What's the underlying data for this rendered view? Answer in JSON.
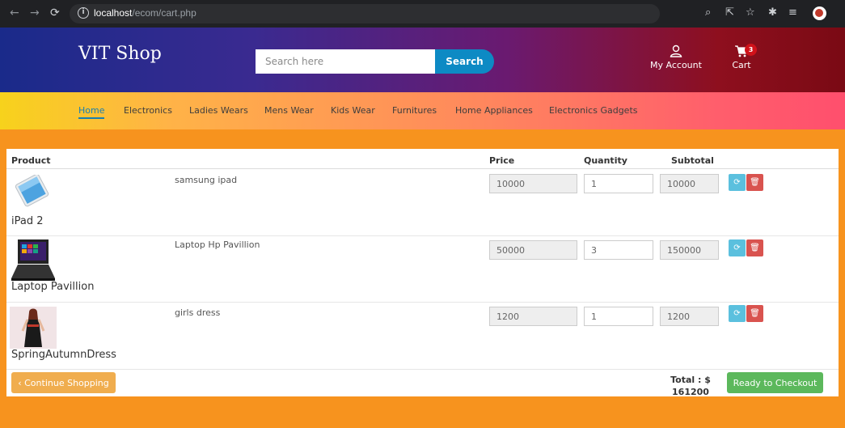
{
  "browser": {
    "host": "localhost",
    "path": "/ecom/cart.php"
  },
  "header": {
    "brand": "VIT Shop",
    "search_placeholder": "Search here",
    "search_label": "Search",
    "account_label": "My Account",
    "cart_label": "Cart",
    "cart_count": "3"
  },
  "categories": [
    {
      "label": "Home",
      "active": true
    },
    {
      "label": "Electronics"
    },
    {
      "label": "Ladies Wears"
    },
    {
      "label": "Mens Wear"
    },
    {
      "label": "Kids Wear"
    },
    {
      "label": "Furnitures"
    },
    {
      "label": "Home Appliances"
    },
    {
      "label": "Electronics Gadgets"
    }
  ],
  "cart": {
    "columns": {
      "product": "Product",
      "price": "Price",
      "quantity": "Quantity",
      "subtotal": "Subtotal"
    },
    "items": [
      {
        "name": "iPad 2",
        "description": "samsung ipad",
        "price": "10000",
        "quantity": "1",
        "subtotal": "10000"
      },
      {
        "name": "Laptop Pavillion",
        "description": "Laptop Hp Pavillion",
        "price": "50000",
        "quantity": "3",
        "subtotal": "150000"
      },
      {
        "name": "SpringAutumnDress",
        "description": "girls dress",
        "price": "1200",
        "quantity": "1",
        "subtotal": "1200"
      }
    ],
    "continue_label": "‹ Continue Shopping",
    "total_label": "Total : $",
    "total_value": "161200",
    "checkout_label": "Ready to Checkout"
  },
  "colors": {
    "accent": "#0d8ac4",
    "refresh": "#5bc0de",
    "delete": "#d9534f",
    "continue": "#f0ad4e",
    "checkout": "#5cb85c"
  }
}
